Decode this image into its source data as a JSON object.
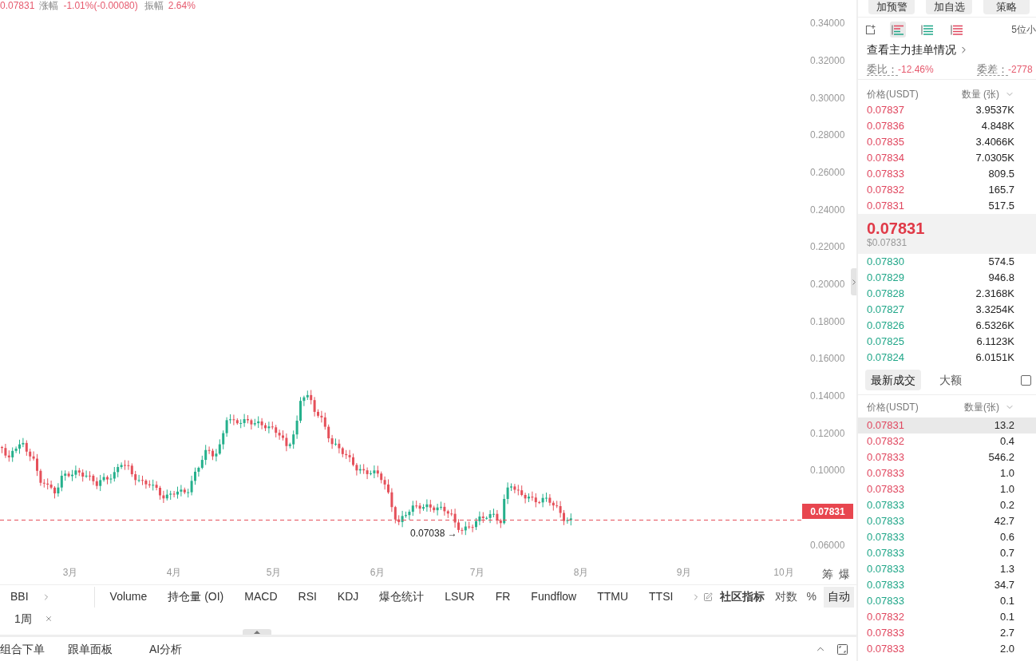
{
  "header": {
    "price": "0.07831",
    "change_label": "涨幅",
    "change": "-1.01%(-0.00080)",
    "amplitude_label": "振幅",
    "amplitude": "2.64%"
  },
  "chart": {
    "y_axis": [
      "0.34000",
      "0.32000",
      "0.30000",
      "0.28000",
      "0.26000",
      "0.24000",
      "0.22000",
      "0.20000",
      "0.18000",
      "0.16000",
      "0.14000",
      "0.12000",
      "0.10000",
      "0.06000"
    ],
    "x_axis": [
      "3月",
      "4月",
      "5月",
      "6月",
      "7月",
      "8月",
      "9月",
      "10月"
    ],
    "last_price_tag": "0.07831",
    "low_marker": "0.07038 →"
  },
  "chart_tools": [
    "筹",
    "爆"
  ],
  "indicator_bar": {
    "pinned": "BBI",
    "items": [
      "Volume",
      "持仓量 (OI)",
      "MACD",
      "RSI",
      "KDJ",
      "爆仓统计",
      "LSUR",
      "FR",
      "Fundflow",
      "TTMU",
      "TTSI"
    ],
    "community": "社区指标",
    "scale_options": [
      {
        "label": "对数",
        "selected": false
      },
      {
        "label": "%",
        "selected": false
      },
      {
        "label": "自动",
        "selected": true
      }
    ]
  },
  "interval_tabs": [
    {
      "label": "1周"
    }
  ],
  "bottom_tabs": [
    "组合下单",
    "跟单面板",
    "AI分析"
  ],
  "side_panel": {
    "top_buttons": [
      "加预警",
      "加自选",
      "策略"
    ],
    "book_views": [
      {
        "kind": "both",
        "selected": true
      },
      {
        "kind": "bids",
        "selected": false
      },
      {
        "kind": "asks",
        "selected": false
      }
    ],
    "precision": "5位小",
    "main_orders_link": "查看主力挂单情况",
    "ratio": {
      "label": "委比：",
      "value": "-12.46%"
    },
    "delta": {
      "label": "委差：",
      "value": "-2778"
    },
    "columns": {
      "price": "价格(USDT)",
      "amount": "数量 (张)"
    },
    "asks": [
      {
        "price": "0.07837",
        "amount": "3.9537K"
      },
      {
        "price": "0.07836",
        "amount": "4.848K"
      },
      {
        "price": "0.07835",
        "amount": "3.4066K"
      },
      {
        "price": "0.07834",
        "amount": "7.0305K"
      },
      {
        "price": "0.07833",
        "amount": "809.5"
      },
      {
        "price": "0.07832",
        "amount": "165.7"
      },
      {
        "price": "0.07831",
        "amount": "517.5"
      }
    ],
    "last_price": "0.07831",
    "last_price_usd": "$0.07831",
    "bids": [
      {
        "price": "0.07830",
        "amount": "574.5"
      },
      {
        "price": "0.07829",
        "amount": "946.8"
      },
      {
        "price": "0.07828",
        "amount": "2.3168K"
      },
      {
        "price": "0.07827",
        "amount": "3.3254K"
      },
      {
        "price": "0.07826",
        "amount": "6.5326K"
      },
      {
        "price": "0.07825",
        "amount": "6.1123K"
      },
      {
        "price": "0.07824",
        "amount": "6.0151K"
      }
    ],
    "trade_tabs": [
      {
        "label": "最新成交",
        "selected": true
      },
      {
        "label": "大额",
        "selected": false
      }
    ],
    "large_only": {
      "checked": false
    },
    "trade_columns": {
      "price": "价格(USDT)",
      "amount": "数量(张)"
    },
    "trades": [
      {
        "price": "0.07831",
        "amount": "13.2",
        "color": "#e0465e",
        "selected": true
      },
      {
        "price": "0.07832",
        "amount": "0.4",
        "color": "#e0465e",
        "selected": false
      },
      {
        "price": "0.07833",
        "amount": "546.2",
        "color": "#e0465e",
        "selected": false
      },
      {
        "price": "0.07833",
        "amount": "1.0",
        "color": "#e0465e",
        "selected": false
      },
      {
        "price": "0.07833",
        "amount": "1.0",
        "color": "#e0465e",
        "selected": false
      },
      {
        "price": "0.07833",
        "amount": "0.2",
        "color": "#1fa688",
        "selected": false
      },
      {
        "price": "0.07833",
        "amount": "42.7",
        "color": "#1fa688",
        "selected": false
      },
      {
        "price": "0.07833",
        "amount": "0.6",
        "color": "#1fa688",
        "selected": false
      },
      {
        "price": "0.07833",
        "amount": "0.7",
        "color": "#1fa688",
        "selected": false
      },
      {
        "price": "0.07833",
        "amount": "1.3",
        "color": "#1fa688",
        "selected": false
      },
      {
        "price": "0.07833",
        "amount": "34.7",
        "color": "#1fa688",
        "selected": false
      },
      {
        "price": "0.07833",
        "amount": "0.1",
        "color": "#1fa688",
        "selected": false
      },
      {
        "price": "0.07832",
        "amount": "0.1",
        "color": "#e0465e",
        "selected": false
      },
      {
        "price": "0.07833",
        "amount": "2.7",
        "color": "#e0465e",
        "selected": false
      },
      {
        "price": "0.07833",
        "amount": "2.0",
        "color": "#e0465e",
        "selected": false
      }
    ]
  }
}
